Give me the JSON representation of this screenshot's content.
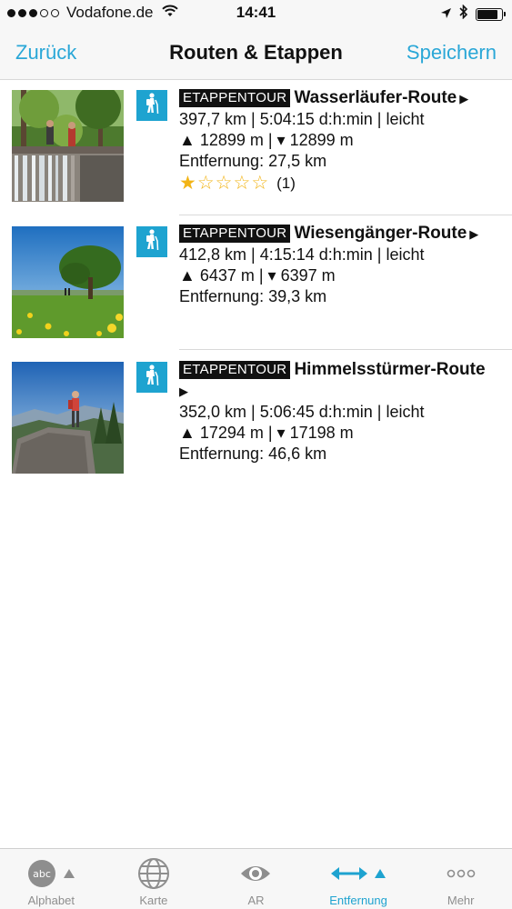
{
  "status_bar": {
    "carrier": "Vodafone.de",
    "time": "14:41",
    "signal_bars": 3,
    "signal_total": 5,
    "battery_level": 0.85
  },
  "nav": {
    "back_label": "Zurück",
    "title": "Routen & Etappen",
    "save_label": "Speichern"
  },
  "routes": [
    {
      "tag": "ETAPPENTOUR",
      "name": "Wasserläufer-Route",
      "stats": "397,7 km | 5:04:15 d:h:min | leicht",
      "elevation": "▲ 12899 m | ▾ 12899 m",
      "distance": "Entfernung: 27,5 km",
      "rating": 1,
      "rating_max": 5,
      "rating_count": "(1)",
      "image": "waterfall-hikers"
    },
    {
      "tag": "ETAPPENTOUR",
      "name": "Wiesengänger-Route",
      "stats": "412,8 km | 4:15:14 d:h:min | leicht",
      "elevation": "▲ 6437 m | ▾ 6397 m",
      "distance": "Entfernung: 39,3 km",
      "image": "meadow-tree"
    },
    {
      "tag": "ETAPPENTOUR",
      "name": "Himmelsstürmer-Route",
      "stats": "352,0 km | 5:06:45 d:h:min | leicht",
      "elevation": "▲ 17294 m | ▾ 17198 m",
      "distance": "Entfernung: 46,6 km",
      "image": "hiker-on-rock"
    }
  ],
  "tabs": [
    {
      "label": "Alphabet",
      "icon": "abc-icon",
      "sort_indicator": true,
      "active": false
    },
    {
      "label": "Karte",
      "icon": "globe-icon",
      "active": false
    },
    {
      "label": "AR",
      "icon": "eye-icon",
      "active": false
    },
    {
      "label": "Entfernung",
      "icon": "distance-arrows-icon",
      "sort_indicator": true,
      "active": true
    },
    {
      "label": "Mehr",
      "icon": "more-dots-icon",
      "active": false
    }
  ],
  "colors": {
    "accent": "#2aa7d7",
    "badge": "#1ea3d0",
    "star": "#f2b416",
    "tag_bg": "#111111"
  }
}
